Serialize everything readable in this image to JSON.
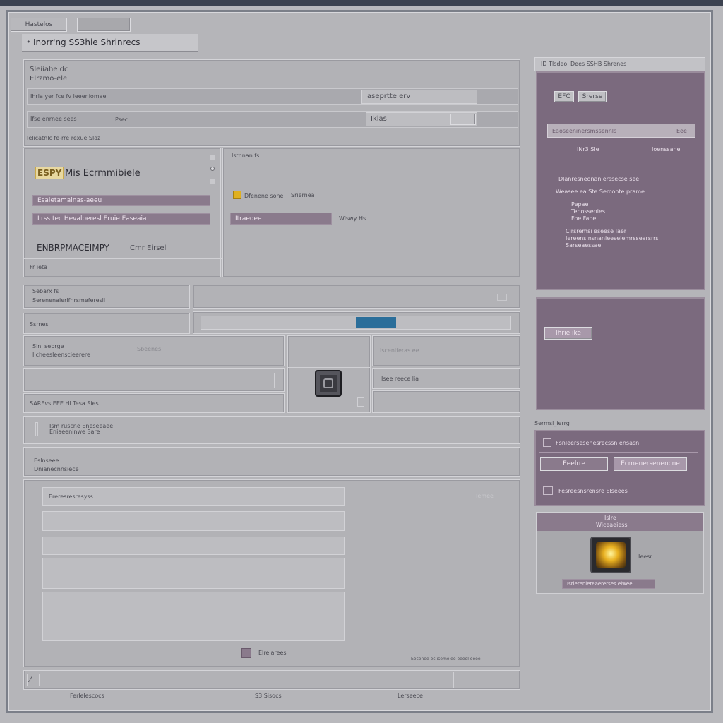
{
  "window": {
    "tab_label": "Hastelos",
    "tab_button": "",
    "title": "Inorr'ng SS3hie Shrinrecs"
  },
  "form": {
    "section_heading_1": "Sleiiahe dc",
    "section_heading_2": "Elrzmo-ele",
    "row1_label": "Ihrla yer fce fv leeeniomae",
    "row1_value": "Iaseprtte erv",
    "row2_label": "Ifse enrnee sees",
    "row2_value": "Psec",
    "row2_right": "Iklas",
    "footnote": "Ielicatnlc fe-rre rexue Slaz"
  },
  "left_box": {
    "logo_text": "ESPY",
    "title": "Mis Ecrmmibiele",
    "bar1": "Esaletamalnas-aeeu",
    "bar2": "Lrss tec Hevaloeresl Eruie Easeaia",
    "big_label": "ENBRPMACEIMPY",
    "big_label_suffix": "Cmr Eirsel",
    "footer": "Fr ieta"
  },
  "mid_box": {
    "heading": "Istnnan fs",
    "checkbox_label": "Dfenene sone",
    "checkbox_label2": "Sriernea",
    "bar_label": "Itraeoee",
    "bar_right": "Wiswy Hs"
  },
  "row3": {
    "label1": "Sebarx fs",
    "label2": "Serenenaierlfnrsmeferesll",
    "label3": "Ssrnes",
    "progress": 0.63
  },
  "grid": {
    "cell1_title": "Slnl sebrge",
    "cell1_sub": "Iicheesleenscieerere",
    "cell1_right": "Sbeenes",
    "cell3_label": "SAREvs EEE Hl Tesa Sies",
    "right_top": "Isceniferas ee",
    "right_mid": "Isee reece lia"
  },
  "line_row": {
    "label": "Ism ruscne Eneseeaee",
    "label2": "Eniaeeninwe Sare"
  },
  "row5": {
    "label1": "Eslnseee",
    "label2": "Dnianecnnsiece"
  },
  "list_area": {
    "item1": "Ereresresresyss",
    "corner": "Iemee",
    "legend": "Elrelarees",
    "legend_color": "#8a7a8c",
    "footer_right": "Eecenee ec isemeiee eeeel eeee"
  },
  "status": {
    "item1": "Ferlelescocs",
    "item2": "S3 Sisocs",
    "item3": "Lerseece"
  },
  "right": {
    "header": "ID Tlsdeol Dees SSHB Shrenes",
    "panel1": {
      "tag1": "EFC",
      "tag2": "Srerse",
      "bar": "Eaoseeninersmssennls",
      "bar_right": "Eee",
      "sub1": "INr3 Sle",
      "sub2": "Ioenssane",
      "line1": "Dlanresneonanlerssecse see",
      "line2": "Weasee ea Ste Serconte prame",
      "line3": "Pepae",
      "line4": "Tenossenies",
      "line5": "Foe Faoe",
      "line6": "Cirsremsi eseese      Iaer",
      "line7": "Iereensinsnanieeseiemrssearsrrs",
      "line8": "Sarseaessae"
    },
    "panel2": {
      "button": "Ihrie ike"
    },
    "section_label": "Sermsl_ierrg",
    "list_item1": "Fsnleersesenesrecssn ensasn",
    "list_btn1": "Eeelrre",
    "list_btn2": "Ecrnenersenencne",
    "list_item3": "Fesreesnsrensre Elseees",
    "card_title": "Islre",
    "card_sub": "Wiceaeiess",
    "card_side": "Ieesr",
    "card_footer": "Isrlereniereaererses eiwee"
  },
  "colors": {
    "accent_purple": "#7b6a7e",
    "progress_blue": "#2b6e9a",
    "checkbox_yellow": "#e0b020"
  }
}
